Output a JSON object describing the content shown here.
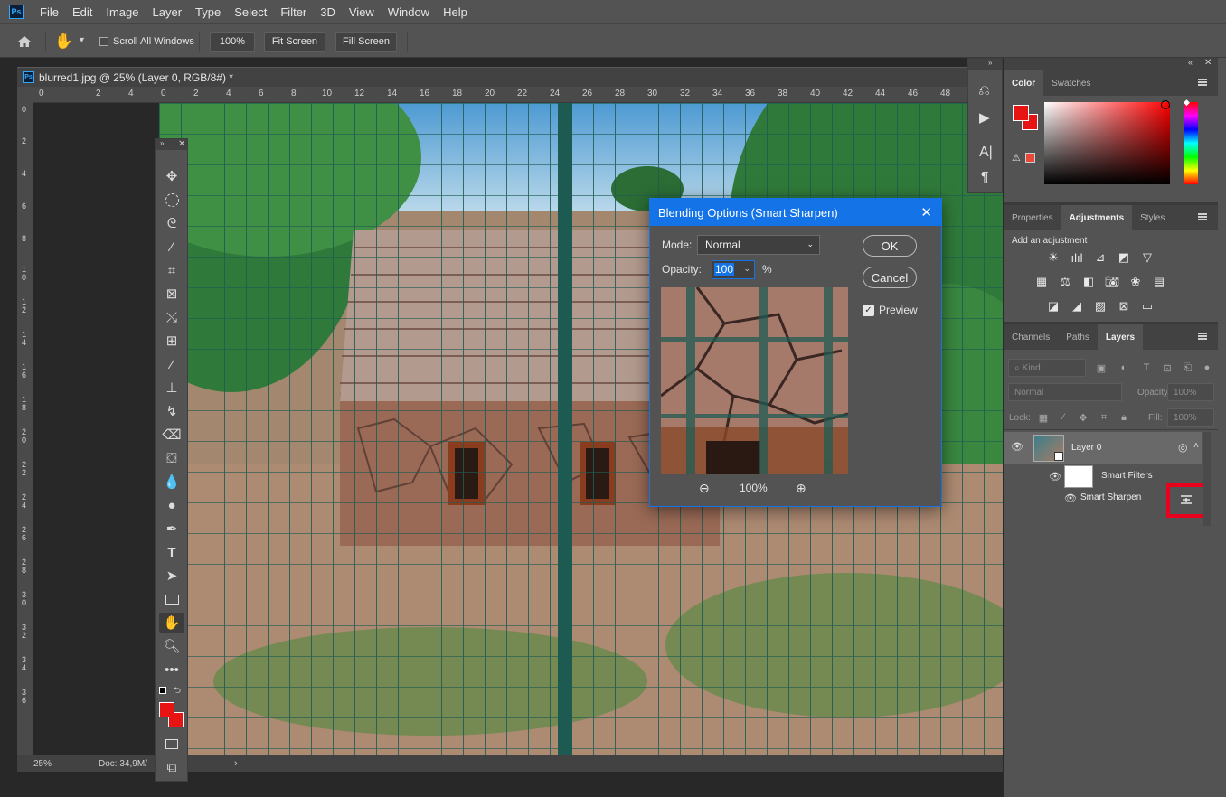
{
  "menu": [
    "File",
    "Edit",
    "Image",
    "Layer",
    "Type",
    "Select",
    "Filter",
    "3D",
    "View",
    "Window",
    "Help"
  ],
  "app_logo": "Ps",
  "options": {
    "scroll_all_windows": "Scroll All Windows",
    "zoom_value": "100%",
    "fit_screen": "Fit Screen",
    "fill_screen": "Fill Screen"
  },
  "document": {
    "tab_title": "blurred1.jpg @ 25% (Layer 0, RGB/8#) *",
    "zoom": "25%",
    "doc_size": "Doc: 34,9M/",
    "ruler_top": [
      "0",
      "2",
      "4",
      "0",
      "2",
      "4",
      "6",
      "8",
      "10",
      "12",
      "14",
      "16",
      "18",
      "20",
      "22",
      "24",
      "26",
      "28",
      "30",
      "32",
      "34",
      "36",
      "38",
      "40",
      "42",
      "44",
      "46",
      "48"
    ],
    "ruler_left": [
      "0",
      "2",
      "4",
      "6",
      "8",
      "1 0",
      "1 2",
      "1 4",
      "1 6",
      "1 8",
      "2 0",
      "2 2",
      "2 4",
      "2 6",
      "2 8",
      "3 0",
      "3 2",
      "3 4",
      "3 6"
    ]
  },
  "dialog": {
    "title": "Blending Options (Smart Sharpen)",
    "mode_label": "Mode:",
    "mode_value": "Normal",
    "opacity_label": "Opacity:",
    "opacity_value": "100",
    "opacity_unit": "%",
    "ok": "OK",
    "cancel": "Cancel",
    "preview_label": "Preview",
    "preview_checked": true,
    "preview_zoom": "100%"
  },
  "color_panel": {
    "tabs": [
      "Color",
      "Swatches"
    ],
    "foreground": "#e81414",
    "background": "#e81414"
  },
  "adjustments_panel": {
    "tabs": [
      "Properties",
      "Adjustments",
      "Styles"
    ],
    "heading": "Add an adjustment"
  },
  "layers_panel": {
    "tabs": [
      "Channels",
      "Paths",
      "Layers"
    ],
    "kind_label": "Kind",
    "blend_mode": "Normal",
    "opacity_label": "Opacity:",
    "opacity_value": "100%",
    "lock_label": "Lock:",
    "fill_label": "Fill:",
    "fill_value": "100%",
    "layers": [
      {
        "name": "Layer 0"
      },
      {
        "name": "Smart Filters"
      },
      {
        "name": "Smart Sharpen"
      }
    ]
  },
  "colors": {
    "accent": "#1473e6",
    "highlight": "#e8001c",
    "panel": "#535353",
    "dark": "#282828"
  }
}
